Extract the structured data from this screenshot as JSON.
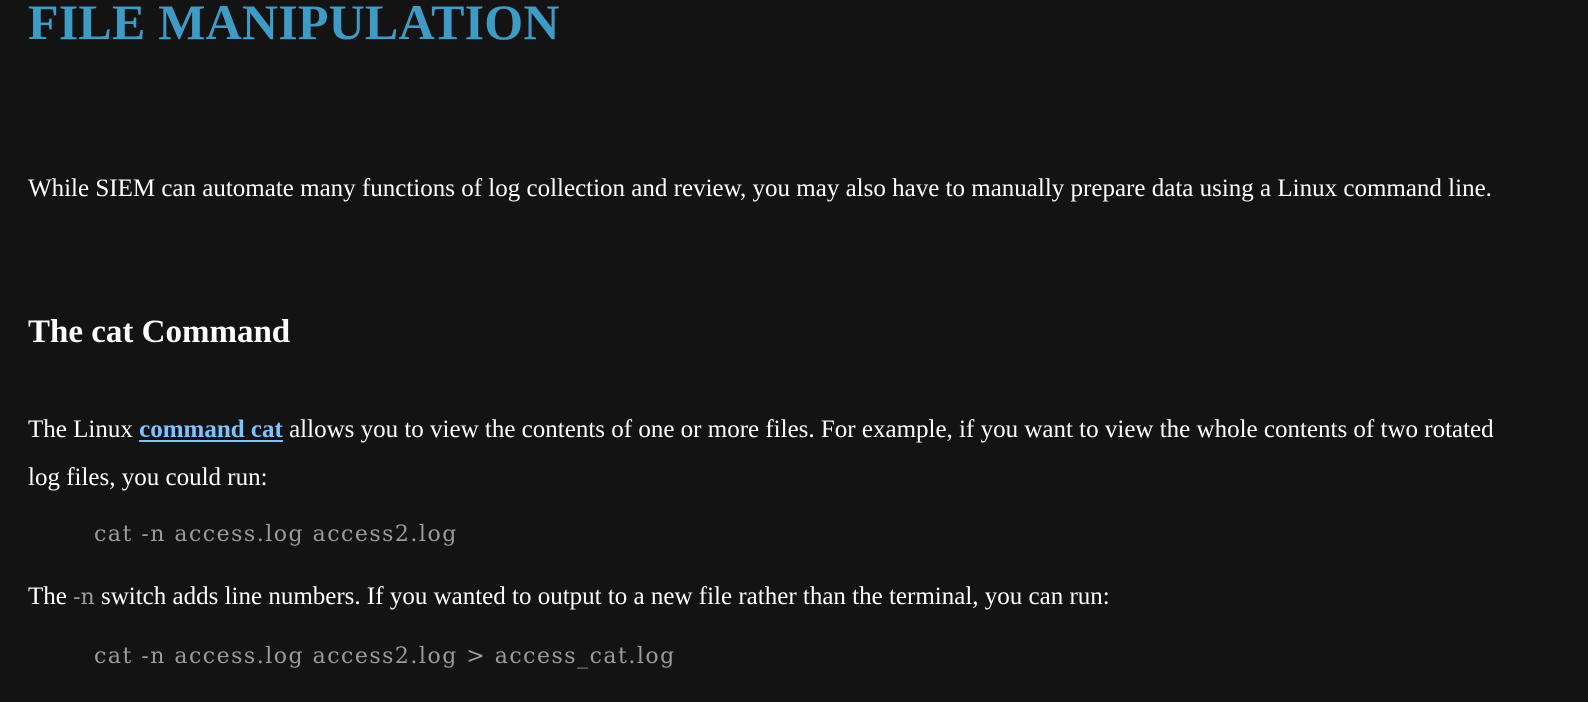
{
  "title": "FILE MANIPULATION",
  "intro": "While SIEM can automate many functions of log collection and review, you may also have to manually prepare data using a Linux command line.",
  "section": {
    "heading": "The cat Command",
    "para1_before": "The Linux ",
    "para1_link": "command cat",
    "para1_after": " allows you to view the contents of one or more files. For example, if you want to view the whole contents of two rotated log files, you could run:",
    "code1": "cat -n access.log access2.log",
    "para2_before": "The ",
    "para2_code": "-n",
    "para2_after": " switch adds line numbers. If you wanted to output to a new file rather than the terminal, you can run:",
    "code2": "cat -n access.log access2.log > access_cat.log"
  },
  "colors": {
    "background": "#131313",
    "title": "#3d9bc6",
    "link": "#7ec3ff",
    "code": "#9a9a9a"
  }
}
